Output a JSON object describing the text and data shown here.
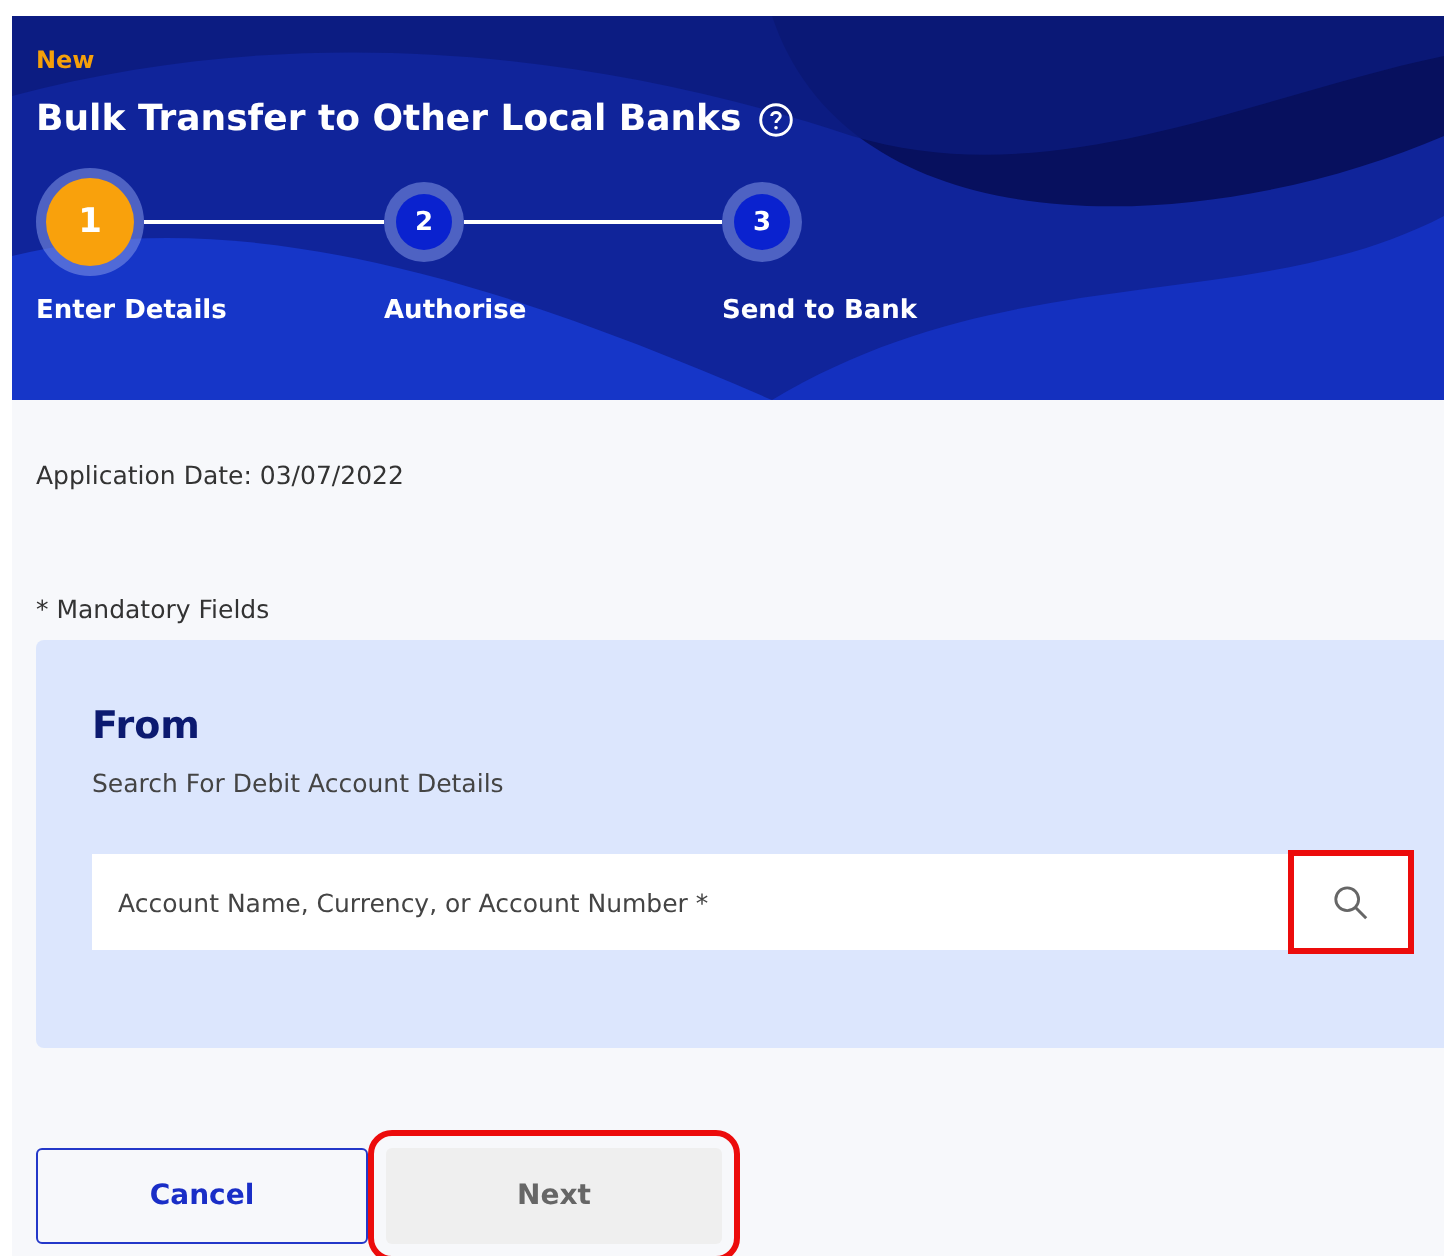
{
  "header": {
    "badge": "New",
    "title": "Bulk Transfer to Other Local Banks",
    "steps": [
      {
        "number": "1",
        "label": "Enter Details",
        "selected": true
      },
      {
        "number": "2",
        "label": "Authorise",
        "selected": false
      },
      {
        "number": "3",
        "label": "Send to Bank",
        "selected": false
      }
    ]
  },
  "application_date": "Application Date: 03/07/2022",
  "mandatory_note": "* Mandatory Fields",
  "from": {
    "title": "From",
    "subtitle": "Search For Debit Account Details",
    "search": {
      "placeholder": "Account Name, Currency, or Account Number *",
      "highlighted": true
    }
  },
  "buttons": [
    {
      "label": "Cancel",
      "kind": "secondary",
      "disabled": false,
      "highlighted": false
    },
    {
      "label": "Next",
      "kind": "primary",
      "disabled": true,
      "highlighted": true
    }
  ]
}
